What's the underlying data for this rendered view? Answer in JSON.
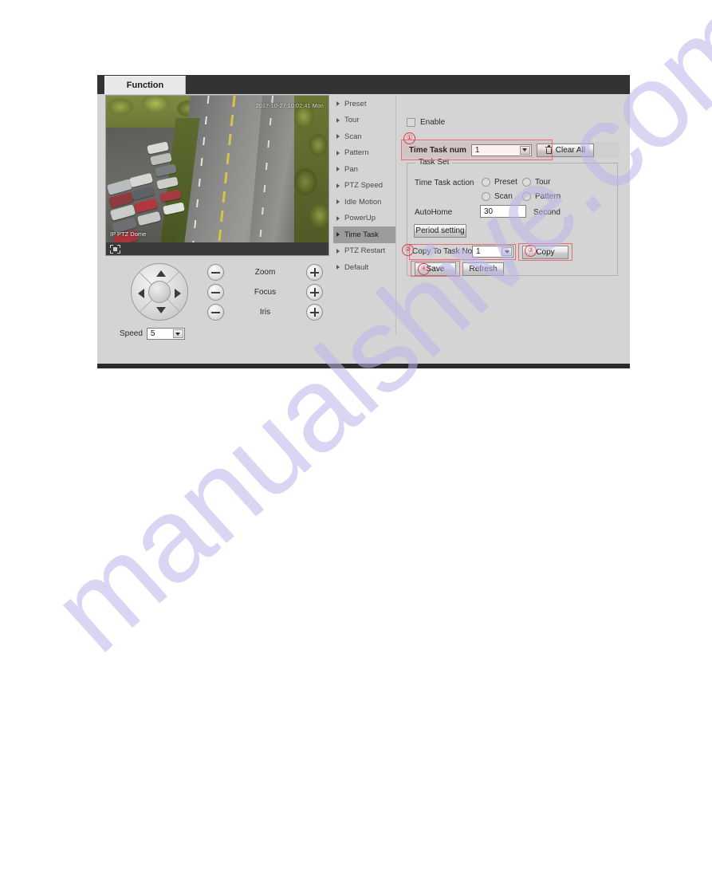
{
  "window": {
    "tab_label": "Function"
  },
  "video": {
    "osd_timestamp": "2017-10-27 10:02:41 Mon",
    "channel_label": "IP PTZ Dome",
    "toolbar_icon": "fullscreen-icon"
  },
  "ptz": {
    "dpad_name": "ptz-direction-pad",
    "controls": [
      {
        "label": "Zoom",
        "minus": "−",
        "plus": "+"
      },
      {
        "label": "Focus",
        "minus": "−",
        "plus": "+"
      },
      {
        "label": "Iris",
        "minus": "−",
        "plus": "+"
      }
    ],
    "speed_label": "Speed",
    "speed_value": "5"
  },
  "menu": {
    "items": [
      {
        "label": "Preset",
        "active": false
      },
      {
        "label": "Tour",
        "active": false
      },
      {
        "label": "Scan",
        "active": false
      },
      {
        "label": "Pattern",
        "active": false
      },
      {
        "label": "Pan",
        "active": false
      },
      {
        "label": "PTZ Speed",
        "active": false
      },
      {
        "label": "Idle Motion",
        "active": false
      },
      {
        "label": "PowerUp",
        "active": false
      },
      {
        "label": "Time Task",
        "active": true
      },
      {
        "label": "PTZ Restart",
        "active": false
      },
      {
        "label": "Default",
        "active": false
      }
    ]
  },
  "form": {
    "enable_label": "Enable",
    "enable_checked": false,
    "time_task_num_label": "Time Task num",
    "time_task_num_value": "1",
    "clear_all_label": "Clear All",
    "taskset_legend": "Task Set",
    "time_task_action_label": "Time Task action",
    "action_options": [
      {
        "label": "Preset",
        "selected": false
      },
      {
        "label": "Tour",
        "selected": false
      },
      {
        "label": "Scan",
        "selected": false
      },
      {
        "label": "Pattern",
        "selected": false
      }
    ],
    "autohome_label": "AutoHome",
    "autohome_value": "30",
    "autohome_unit": "Second",
    "period_setting_label": "Period setting",
    "copy_to_task_label": "Copy To Task No.",
    "copy_to_task_value": "1",
    "copy_label": "Copy",
    "save_label": "Save",
    "refresh_label": "Refresh"
  },
  "annotations": {
    "one": "①",
    "two": "②",
    "three": "③",
    "four": "④",
    "highlight_color": "#e86a72"
  },
  "watermark": {
    "text": "manualshive.com"
  }
}
